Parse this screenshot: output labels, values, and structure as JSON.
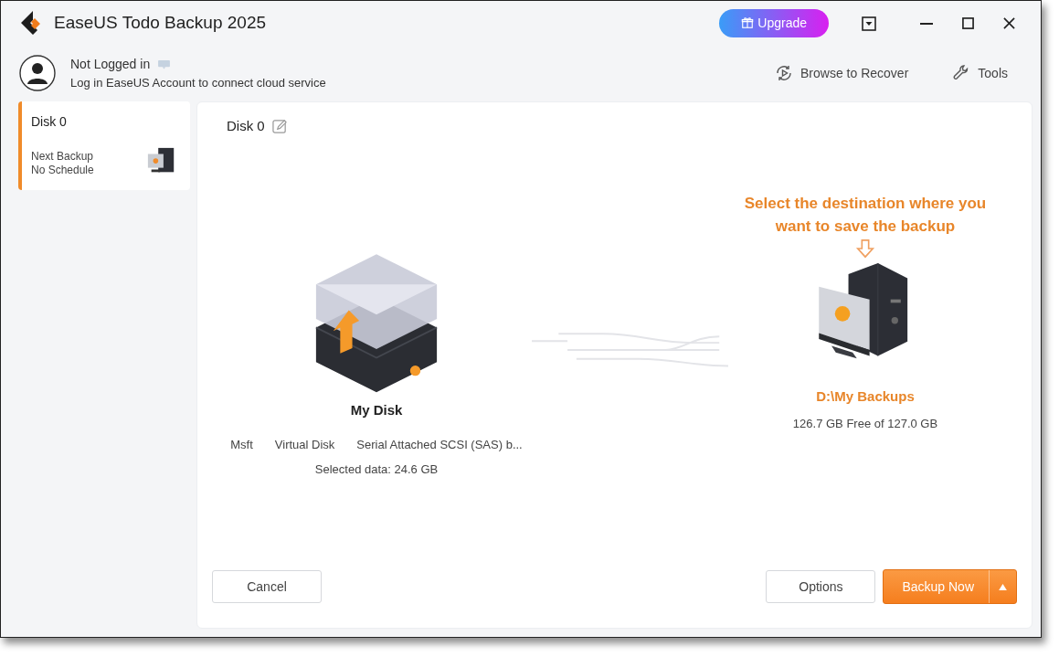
{
  "window": {
    "title": "EaseUS Todo Backup 2025"
  },
  "upgrade": {
    "label": "Upgrade"
  },
  "account": {
    "status": "Not Logged in",
    "description": "Log in EaseUS Account to connect cloud service"
  },
  "toolbar": [
    {
      "kind": "recover",
      "label": "Browse to Recover"
    },
    {
      "kind": "tools",
      "label": "Tools"
    }
  ],
  "sidebar": {
    "items": [
      {
        "title": "Disk 0",
        "next_label": "Next Backup",
        "schedule": "No Schedule",
        "selected": true
      }
    ]
  },
  "main": {
    "title": "Disk 0",
    "source": {
      "name": "My Disk",
      "details": [
        "Msft",
        "Virtual Disk",
        "Serial Attached SCSI (SAS) b..."
      ],
      "selected_data": "Selected data: 24.6 GB"
    },
    "destination": {
      "hint": "Select the destination where you want to save the backup",
      "path": "D:\\My Backups",
      "free": "126.7 GB Free of 127.0 GB"
    },
    "buttons": {
      "cancel": "Cancel",
      "options": "Options",
      "primary": "Backup Now"
    }
  }
}
